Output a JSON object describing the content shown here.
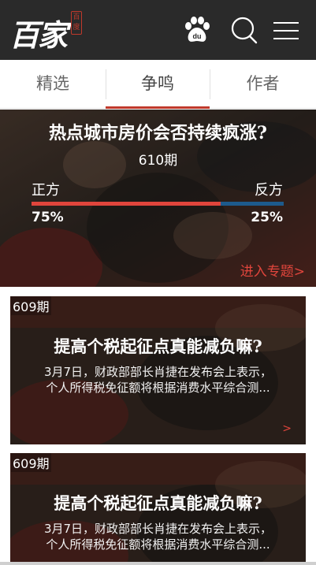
{
  "header": {
    "logo_text": "百家",
    "logo_seal": "百度",
    "icons": [
      "baidu-paw-icon",
      "search-icon",
      "menu-icon"
    ]
  },
  "tabs": [
    {
      "label": "精选",
      "active": false
    },
    {
      "label": "争鸣",
      "active": true
    },
    {
      "label": "作者",
      "active": false
    }
  ],
  "hero": {
    "title": "热点城市房价会否持续疯涨?",
    "issue": "610期",
    "left_side": "正方",
    "right_side": "反方",
    "left_pct": "75%",
    "right_pct": "25%",
    "left_fraction": 0.75,
    "link": "进入专题>"
  },
  "cards": [
    {
      "issue": "609期",
      "title": "提高个税起征点真能减负嘛?",
      "desc_line1": "3月7日，财政部部长肖捷在发布会上表示，",
      "desc_line2": "个人所得税免征额将根据消费水平综合测...",
      "arrow": ">"
    },
    {
      "issue": "609期",
      "title": "提高个税起征点真能减负嘛?",
      "desc_line1": "3月7日，财政部部长肖捷在发布会上表示，",
      "desc_line2": "个人所得税免征额将根据消费水平综合测..."
    }
  ],
  "colors": {
    "header_bg": "#2a2a2a",
    "accent_red": "#e0453c",
    "vote_blue": "#1d5a8c"
  }
}
